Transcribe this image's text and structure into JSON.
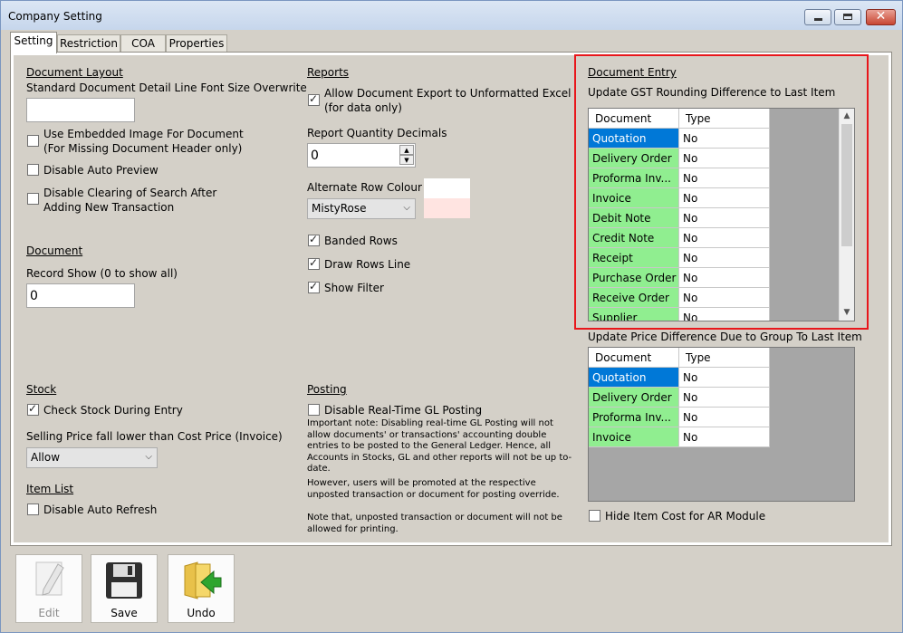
{
  "window": {
    "title": "Company Setting",
    "min_label": "—",
    "close_label": "✕"
  },
  "tabs": [
    "Setting",
    "Restriction",
    "COA",
    "Properties"
  ],
  "doc_layout": {
    "heading": "Document Layout",
    "font_size_label": "Standard Document Detail Line Font Size Overwrite",
    "font_size_value": "",
    "embedded_image_line1": "Use Embedded Image For Document",
    "embedded_image_line2": "(For Missing Document Header only)",
    "disable_preview": "Disable Auto Preview",
    "disable_clearing_line1": "Disable Clearing of Search After",
    "disable_clearing_line2": "Adding New Transaction"
  },
  "document": {
    "heading": "Document",
    "record_show_label": "Record Show (0 to show all)",
    "record_show_value": "0"
  },
  "stock": {
    "heading": "Stock",
    "check_stock": "Check Stock During Entry",
    "selling_price_label": "Selling Price fall lower than Cost Price (Invoice)",
    "selling_price_value": "Allow"
  },
  "item_list": {
    "heading": "Item List",
    "disable_refresh": "Disable Auto Refresh"
  },
  "reports": {
    "heading": "Reports",
    "allow_export_line1": "Allow Document Export to Unformatted Excel",
    "allow_export_line2": "(for data only)",
    "qty_decimals_label": "Report Quantity Decimals",
    "qty_decimals_value": "0",
    "alt_row_label": "Alternate Row Colour",
    "alt_row_value": "MistyRose",
    "banded_rows": "Banded Rows",
    "draw_rows_line": "Draw Rows Line",
    "show_filter": "Show Filter",
    "alt_row_color": "#ffe4e1"
  },
  "posting": {
    "heading": "Posting",
    "disable_gl": "Disable Real-Time GL Posting",
    "note1": "Important note: Disabling real-time GL Posting will not allow documents' or transactions' accounting double entries to be posted to the General Ledger. Hence, all Accounts in Stocks, GL and other reports will not be up to-date.",
    "note2": "However, users will be promoted at the respective unposted transaction or document for posting override.",
    "note3": "Note that, unposted transaction or document will not be allowed for printing."
  },
  "doc_entry": {
    "heading": "Document Entry",
    "gst_label": "Update GST Rounding Difference to Last Item",
    "col_document": "Document",
    "col_type": "Type",
    "rows": [
      {
        "doc": "Quotation",
        "type": "No"
      },
      {
        "doc": "Delivery Order",
        "type": "No"
      },
      {
        "doc": "Proforma Inv...",
        "type": "No"
      },
      {
        "doc": "Invoice",
        "type": "No"
      },
      {
        "doc": "Debit Note",
        "type": "No"
      },
      {
        "doc": "Credit Note",
        "type": "No"
      },
      {
        "doc": "Receipt",
        "type": "No"
      },
      {
        "doc": "Purchase Order",
        "type": "No"
      },
      {
        "doc": "Receive Order",
        "type": "No"
      },
      {
        "doc": "Supplier Invoice",
        "type": "No"
      }
    ],
    "price_label": "Update Price Difference Due to Group To Last Item",
    "price_rows": [
      {
        "doc": "Quotation",
        "type": "No"
      },
      {
        "doc": "Delivery Order",
        "type": "No"
      },
      {
        "doc": "Proforma Inv...",
        "type": "No"
      },
      {
        "doc": "Invoice",
        "type": "No"
      }
    ],
    "hide_cost": "Hide Item Cost for AR Module"
  },
  "toolbar": {
    "edit": "Edit",
    "save": "Save",
    "undo": "Undo"
  },
  "colors": {
    "highlight": "#e8161b",
    "doc_cell": "#90ee90",
    "selected": "#0078d7"
  }
}
